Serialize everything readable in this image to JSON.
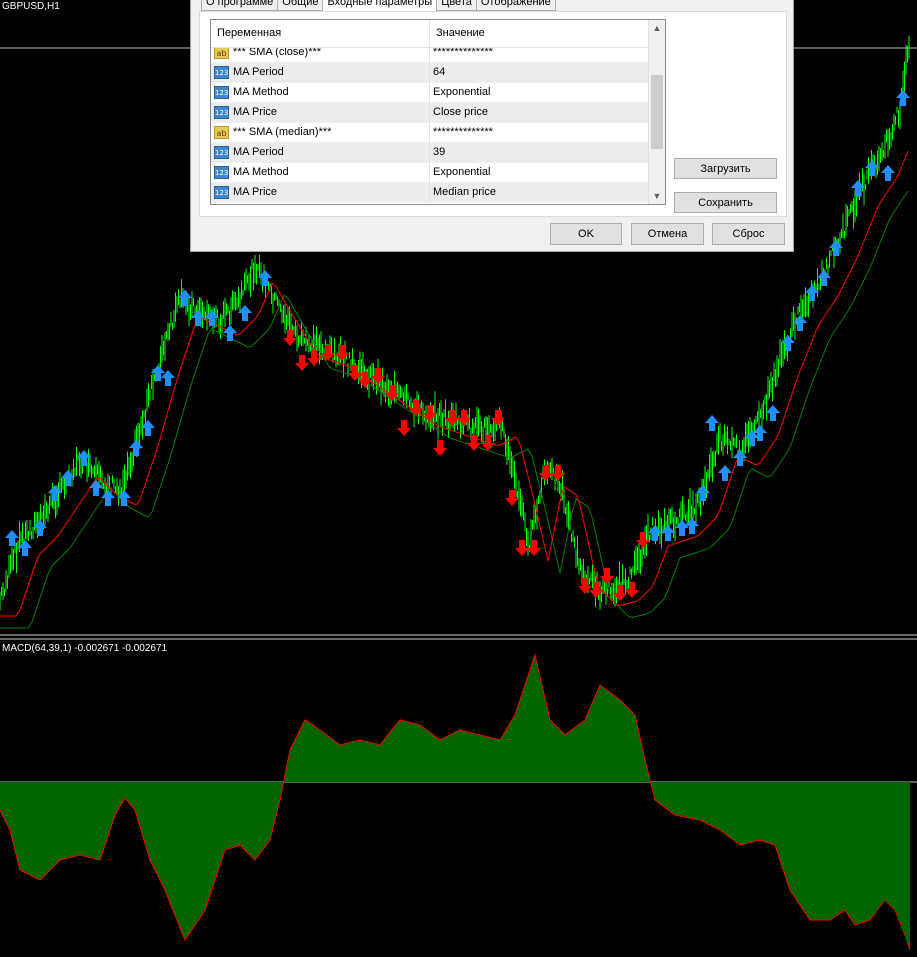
{
  "chart": {
    "symbol_label": "GBPUSD,H1",
    "macd_label": "MACD(64,39,1) -0.002671 -0.002671",
    "colors": {
      "background": "#000000",
      "price": "#00ff00",
      "ma_fast": "#ff0000",
      "ma_slow": "#008000",
      "buy_arrow": "#1e90ff",
      "sell_arrow": "#ff0000",
      "macd_fill": "#006400",
      "macd_line": "#ff0000"
    }
  },
  "dialog": {
    "tabs": [
      "О программе",
      "Общие",
      "Входные параметры",
      "Цвета",
      "Отображение"
    ],
    "active_tab": "Входные параметры",
    "table": {
      "headers": [
        "Переменная",
        "Значение"
      ],
      "rows": [
        {
          "icon": "string-icon",
          "name": "*** SMA (close)***",
          "value": "**************"
        },
        {
          "icon": "number-icon",
          "name": "MA Period",
          "value": "64"
        },
        {
          "icon": "number-icon",
          "name": "MA Method",
          "value": "Exponential"
        },
        {
          "icon": "number-icon",
          "name": "MA Price",
          "value": "Close price"
        },
        {
          "icon": "string-icon",
          "name": "*** SMA (median)***",
          "value": "**************"
        },
        {
          "icon": "number-icon",
          "name": "MA Period",
          "value": "39"
        },
        {
          "icon": "number-icon",
          "name": "MA Method",
          "value": "Exponential"
        },
        {
          "icon": "number-icon",
          "name": "MA Price",
          "value": "Median price"
        }
      ]
    },
    "buttons": {
      "load": "Загрузить",
      "save": "Сохранить",
      "ok": "OK",
      "cancel": "Отмена",
      "reset": "Сброс"
    }
  }
}
